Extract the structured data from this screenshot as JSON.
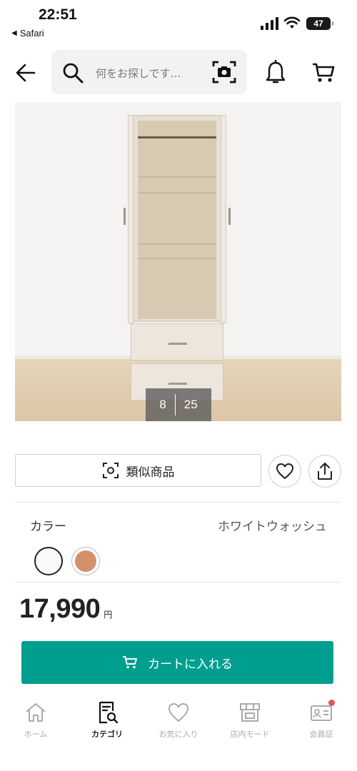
{
  "status_bar": {
    "time": "22:51",
    "back_app": "Safari",
    "battery": "47"
  },
  "header": {
    "search_placeholder": "何をお探しです…",
    "icons": [
      "back-arrow-icon",
      "search-icon",
      "camera-search-icon",
      "bell-icon",
      "cart-icon"
    ]
  },
  "gallery": {
    "current": "8",
    "total": "25"
  },
  "actions": {
    "similar_label": "類似商品"
  },
  "color": {
    "label": "カラー",
    "selected": "ホワイトウォッシュ",
    "swatches": [
      "#fbf9f7",
      "#d2916a"
    ]
  },
  "price": {
    "amount": "17,990",
    "unit": "円"
  },
  "cart_button": {
    "label": "カートに入れる",
    "color": "#009e8f"
  },
  "bottom_nav": {
    "items": [
      {
        "label": "ホーム",
        "icon": "home-icon"
      },
      {
        "label": "カテゴリ",
        "icon": "category-icon"
      },
      {
        "label": "お気に入り",
        "icon": "heart-icon"
      },
      {
        "label": "店内モード",
        "icon": "store-icon"
      },
      {
        "label": "会員証",
        "icon": "member-card-icon"
      }
    ],
    "active_index": 1
  }
}
